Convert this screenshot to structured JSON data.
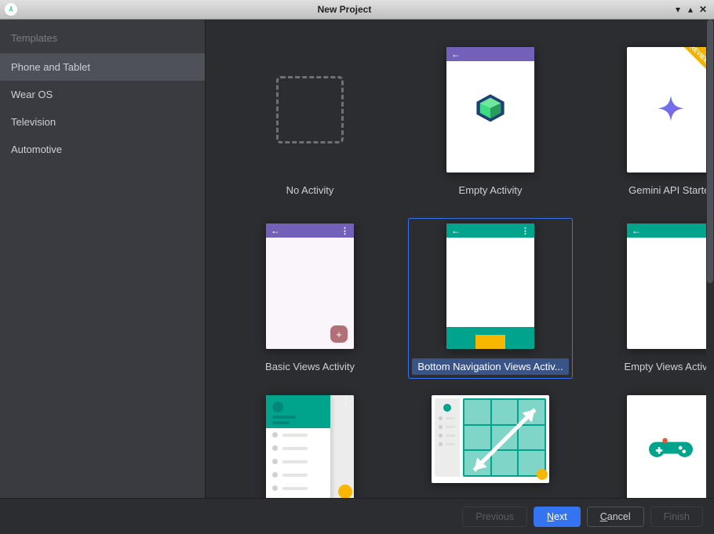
{
  "window": {
    "title": "New Project"
  },
  "sidebar": {
    "header": "Templates",
    "items": [
      {
        "label": "Phone and Tablet",
        "selected": true
      },
      {
        "label": "Wear OS",
        "selected": false
      },
      {
        "label": "Television",
        "selected": false
      },
      {
        "label": "Automotive",
        "selected": false
      }
    ]
  },
  "templates": [
    {
      "id": "no-activity",
      "label": "No Activity"
    },
    {
      "id": "empty-activity",
      "label": "Empty Activity"
    },
    {
      "id": "gemini-api-starter",
      "label": "Gemini API Starter",
      "ribbon": "PREVIEW"
    },
    {
      "id": "basic-views-activity",
      "label": "Basic Views Activity"
    },
    {
      "id": "bottom-navigation-views-activity",
      "label": "Bottom Navigation Views Activ...",
      "selected": true
    },
    {
      "id": "empty-views-activity",
      "label": "Empty Views Activity"
    },
    {
      "id": "navigation-drawer-views-activity",
      "label": ""
    },
    {
      "id": "responsive-views-activity",
      "label": ""
    },
    {
      "id": "game-activity",
      "label": ""
    }
  ],
  "footer": {
    "previous": "Previous",
    "next": "Next",
    "cancel": "Cancel",
    "finish": "Finish"
  }
}
